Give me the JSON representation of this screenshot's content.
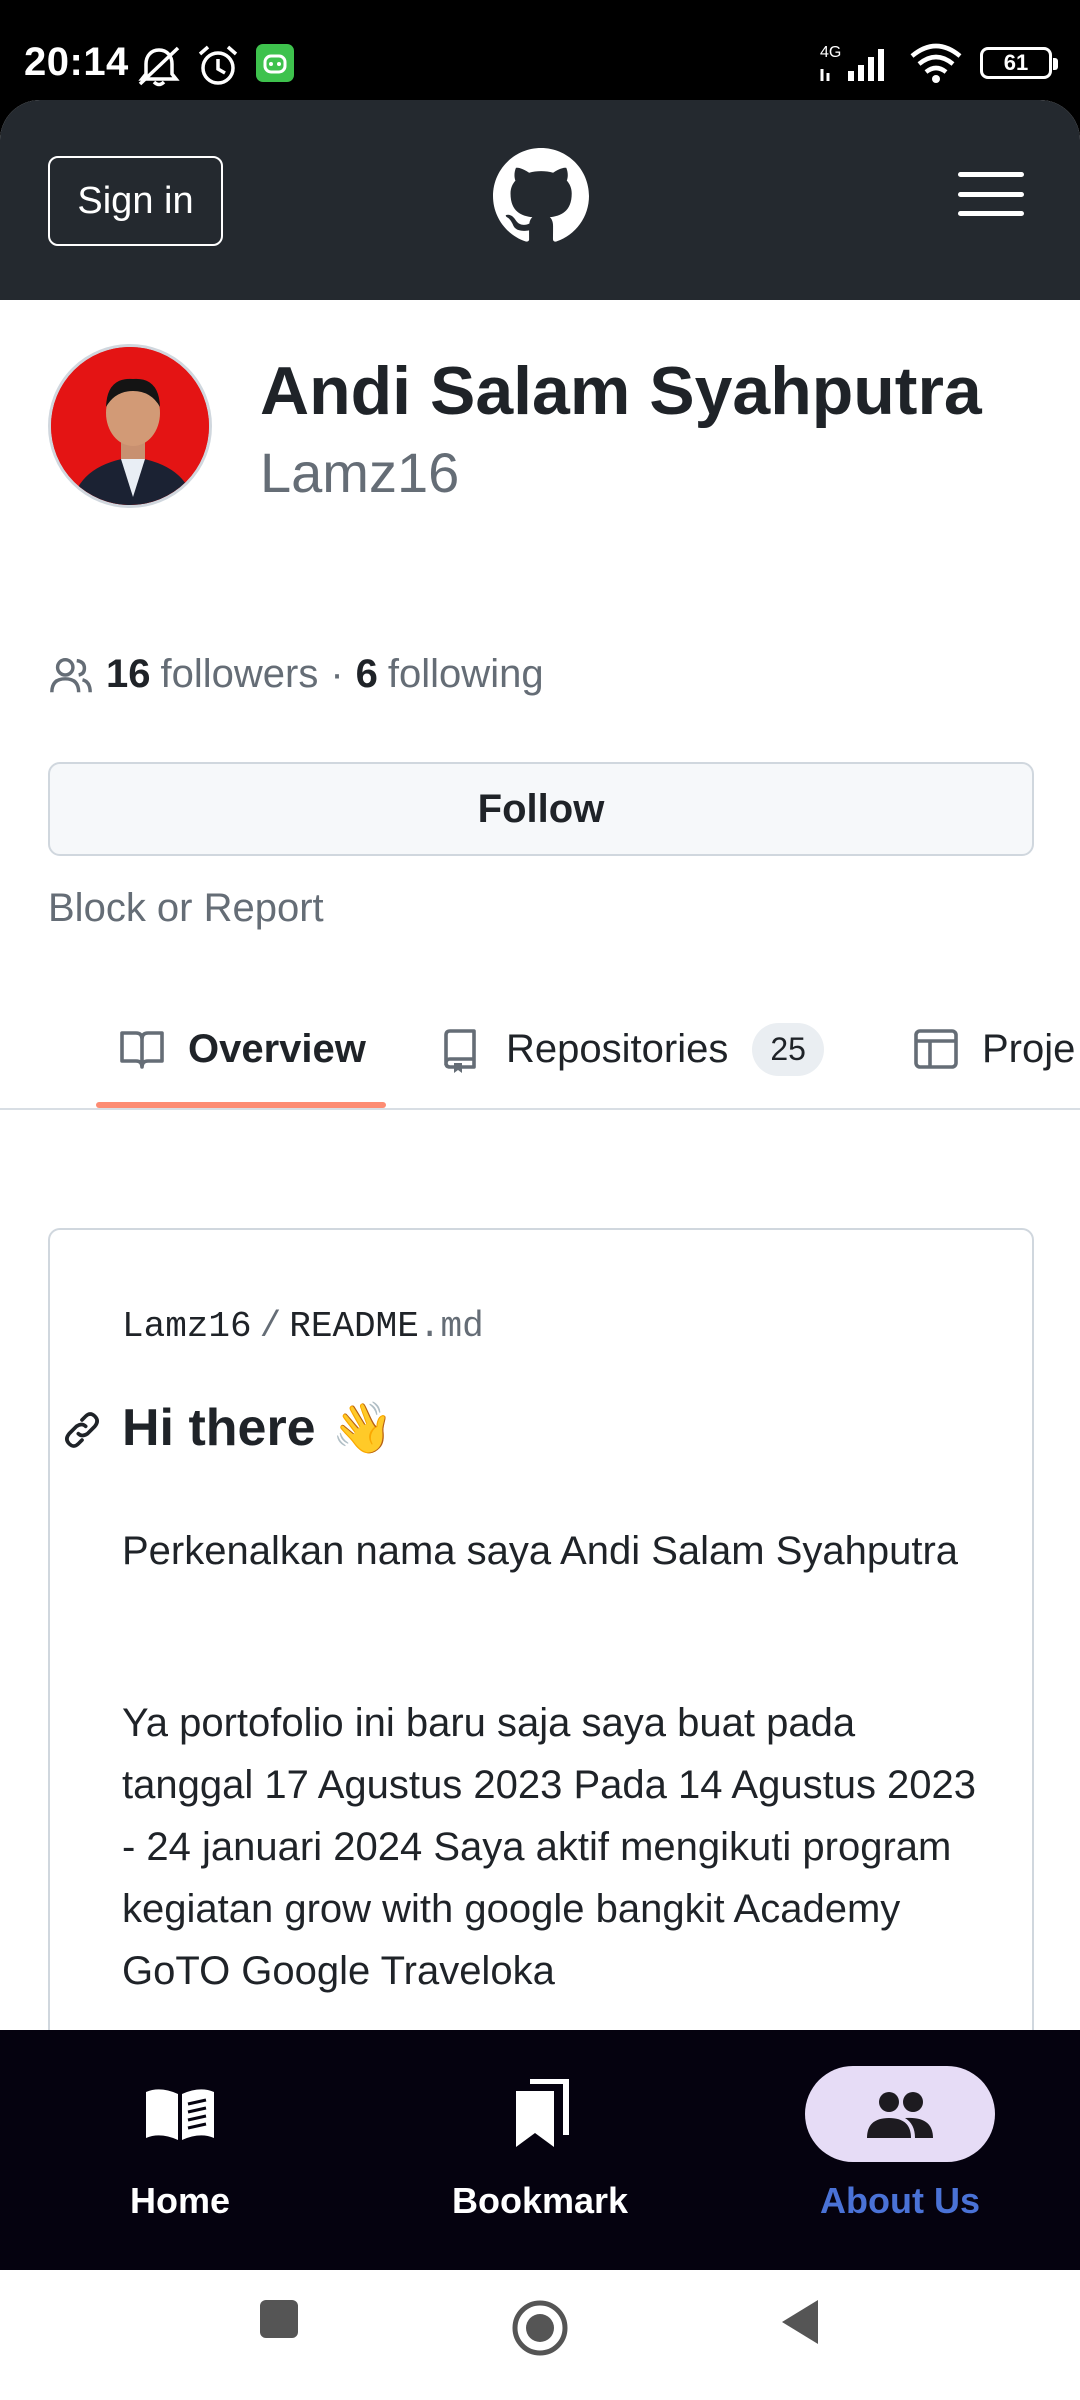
{
  "status_bar": {
    "time": "20:14",
    "network": "4G",
    "battery": "61",
    "icons": [
      "mute-bell-icon",
      "alarm-icon",
      "android-app-icon",
      "signal-icon",
      "wifi-icon",
      "battery-icon"
    ]
  },
  "header": {
    "sign_in_label": "Sign in",
    "logo": "github-logo-icon",
    "menu_icon": "hamburger-menu-icon"
  },
  "profile": {
    "full_name": "Andi Salam Syahputra",
    "username": "Lamz16",
    "followers_count": "16",
    "followers_label": "followers",
    "separator": "·",
    "following_count": "6",
    "following_label": "following",
    "follow_button": "Follow",
    "block_report": "Block or Report"
  },
  "tabs": [
    {
      "label": "Overview",
      "icon": "book-icon",
      "active": true
    },
    {
      "label": "Repositories",
      "icon": "repo-icon",
      "count": "25"
    },
    {
      "label": "Proje",
      "icon": "table-icon"
    }
  ],
  "readme": {
    "owner": "Lamz16",
    "separator": "/",
    "file_name": "README",
    "file_ext": ".md",
    "heading": "Hi there",
    "heading_emoji": "👋",
    "paragraph_1": "Perkenalkan nama saya Andi Salam Syahputra",
    "paragraph_2": "Ya portofolio ini baru saja saya buat pada tanggal 17 Agustus 2023 Pada 14 Agustus 2023 - 24 januari 2024 Saya aktif mengikuti program kegiatan grow with google bangkit Academy GoTO Google Traveloka"
  },
  "bottom_nav": [
    {
      "label": "Home",
      "icon": "book-open-icon",
      "active": false
    },
    {
      "label": "Bookmark",
      "icon": "bookmark-icon",
      "active": false
    },
    {
      "label": "About Us",
      "icon": "people-icon",
      "active": true
    }
  ],
  "colors": {
    "header_bg": "#24292f",
    "tab_underline": "#fd8c73",
    "nav_bg": "#05020f",
    "nav_active_pill": "#e6dcf6",
    "nav_active_label": "#4a72d6"
  }
}
